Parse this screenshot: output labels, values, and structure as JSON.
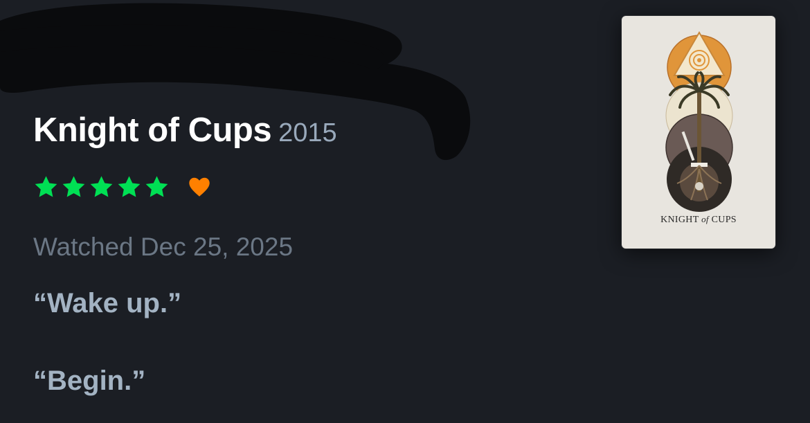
{
  "film": {
    "title": "Knight of Cups",
    "year": "2015"
  },
  "rating": {
    "stars": 5,
    "max_stars": 5,
    "liked": true,
    "star_icon": "star-icon",
    "heart_icon": "heart-icon",
    "star_color": "#00e054",
    "heart_color": "#ff8000"
  },
  "watched": {
    "label": "Watched Dec 25, 2025"
  },
  "review": {
    "lines": [
      "“Wake up.”",
      "“Begin.”"
    ]
  },
  "poster": {
    "caption_pre": "KNIGHT ",
    "caption_of": "of",
    "caption_post": " CUPS"
  },
  "colors": {
    "background": "#1b1e24",
    "title": "#ffffff",
    "year": "#99a9bb",
    "date": "#6b7785",
    "review": "#a3b3c3"
  }
}
